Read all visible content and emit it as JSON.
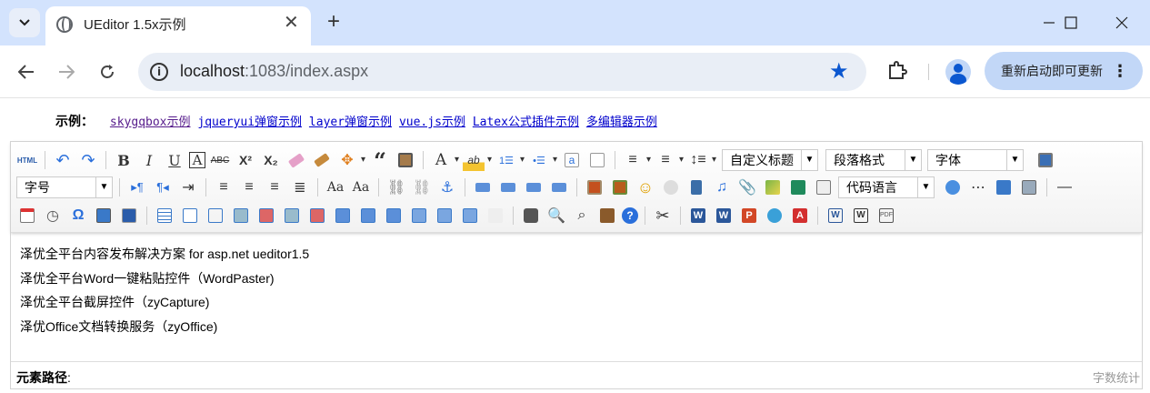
{
  "browser": {
    "tab_title": "UEditor 1.5x示例",
    "tab_close": "✕",
    "new_tab": "+",
    "url_host": "localhost",
    "url_rest": ":1083/index.aspx",
    "update_label": "重新启动即可更新",
    "update_menu": "⋮",
    "accent": "#0b57d0",
    "tabstrip_color": "#d3e3fd"
  },
  "page": {
    "examples_label": "示例：",
    "examples": [
      "skygqbox示例",
      "jqueryui弹窗示例",
      "layer弹窗示例",
      "vue.js示例",
      "Latex公式插件示例",
      "多编辑器示例"
    ]
  },
  "editor": {
    "combos": {
      "custom_title": "自定义标题",
      "paragraph": "段落格式",
      "font_family": "字体",
      "font_size": "字号",
      "code_lang": "代码语言"
    },
    "content_lines": [
      "泽优全平台内容发布解决方案 for asp.net ueditor1.5",
      "泽优全平台Word一键粘贴控件（WordPaster)",
      "泽优全平台截屏控件（zyCapture)",
      "泽优Office文档转换服务（zyOffice)"
    ],
    "element_path_label": "元素路径",
    "element_path_colon": ":",
    "word_count_label": "字数统计"
  }
}
